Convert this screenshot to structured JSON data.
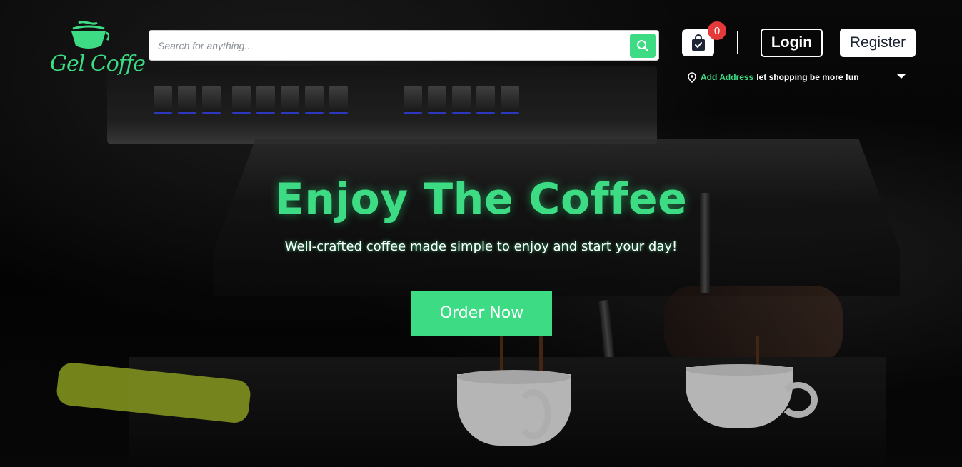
{
  "brand": {
    "name": "Gel Coffe",
    "accent_color": "#3ddc84"
  },
  "search": {
    "placeholder": "Search for anything...",
    "button_icon": "search-icon"
  },
  "cart": {
    "icon": "shopping-bag-check-icon",
    "count": "0"
  },
  "auth": {
    "login_label": "Login",
    "register_label": "Register"
  },
  "address": {
    "icon": "location-pin-icon",
    "add_label": "Add Address",
    "tagline": "let shopping be more fun",
    "caret_icon": "caret-down-icon"
  },
  "hero": {
    "title": "Enjoy The Coffee",
    "subtitle": "Well-crafted coffee made simple to enjoy and start your day!",
    "cta_label": "Order Now"
  }
}
